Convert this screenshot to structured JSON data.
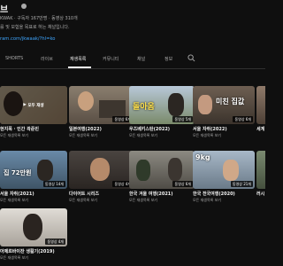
{
  "channel": {
    "title": "브",
    "meta": "KWAK · 구독자 167만명 · 동영상 310개",
    "description": "를 및 모험을 목표로 하는 채널입니다.",
    "link": "ram.com/jkwaak/?hl=ko"
  },
  "tabs": [
    {
      "label": "SHORTS"
    },
    {
      "label": "라이브"
    },
    {
      "label": "재생목록"
    },
    {
      "label": "커뮤니티"
    },
    {
      "label": "채널"
    },
    {
      "label": "정보"
    }
  ],
  "colors": {
    "background": "#0f0f0f",
    "accent_link": "#3ea6ff",
    "muted": "#aaaaaa"
  },
  "playlists": [
    {
      "title": "현지폭 · 인간 곽준빈",
      "count": "",
      "overlay": "모두 재생",
      "link": "모든 재생목록 보기"
    },
    {
      "title": "일본여행(2022)",
      "count": "동영상 6개",
      "link": "모든 재생목록 보기"
    },
    {
      "title": "우즈베키스탄(2022)",
      "count": "동영상 5개",
      "thumb_text": "돌아옴",
      "link": "모든 재생목록 보기"
    },
    {
      "title": "서울 자취(2022)",
      "count": "동영상 6개",
      "thumb_text": "미친 집값",
      "link": "모든 재생목록 보기"
    },
    {
      "title": "세계",
      "count": "동영상",
      "link": ""
    },
    {
      "title": "서울 자취(2021)",
      "count": "동영상 14개",
      "thumb_text": "집 72만원",
      "link": "모든 재생목록 보기"
    },
    {
      "title": "다이어트 시리즈",
      "count": "동영상 4개",
      "link": "모든 재생목록 보기"
    },
    {
      "title": "한국 겨울 여행(2021)",
      "count": "동영상 6개",
      "link": "모든 재생목록 보기"
    },
    {
      "title": "한국 전국여행(2020)",
      "count": "동영상 21개",
      "thumb_text": "9kg",
      "link": "모든 재생목록 보기"
    },
    {
      "title": "러시",
      "count": "동영상",
      "link": ""
    },
    {
      "title": "아제르바이잔 생활기(2019)",
      "count": "동영상 4개",
      "link": "모든 재생목록 보기"
    }
  ]
}
